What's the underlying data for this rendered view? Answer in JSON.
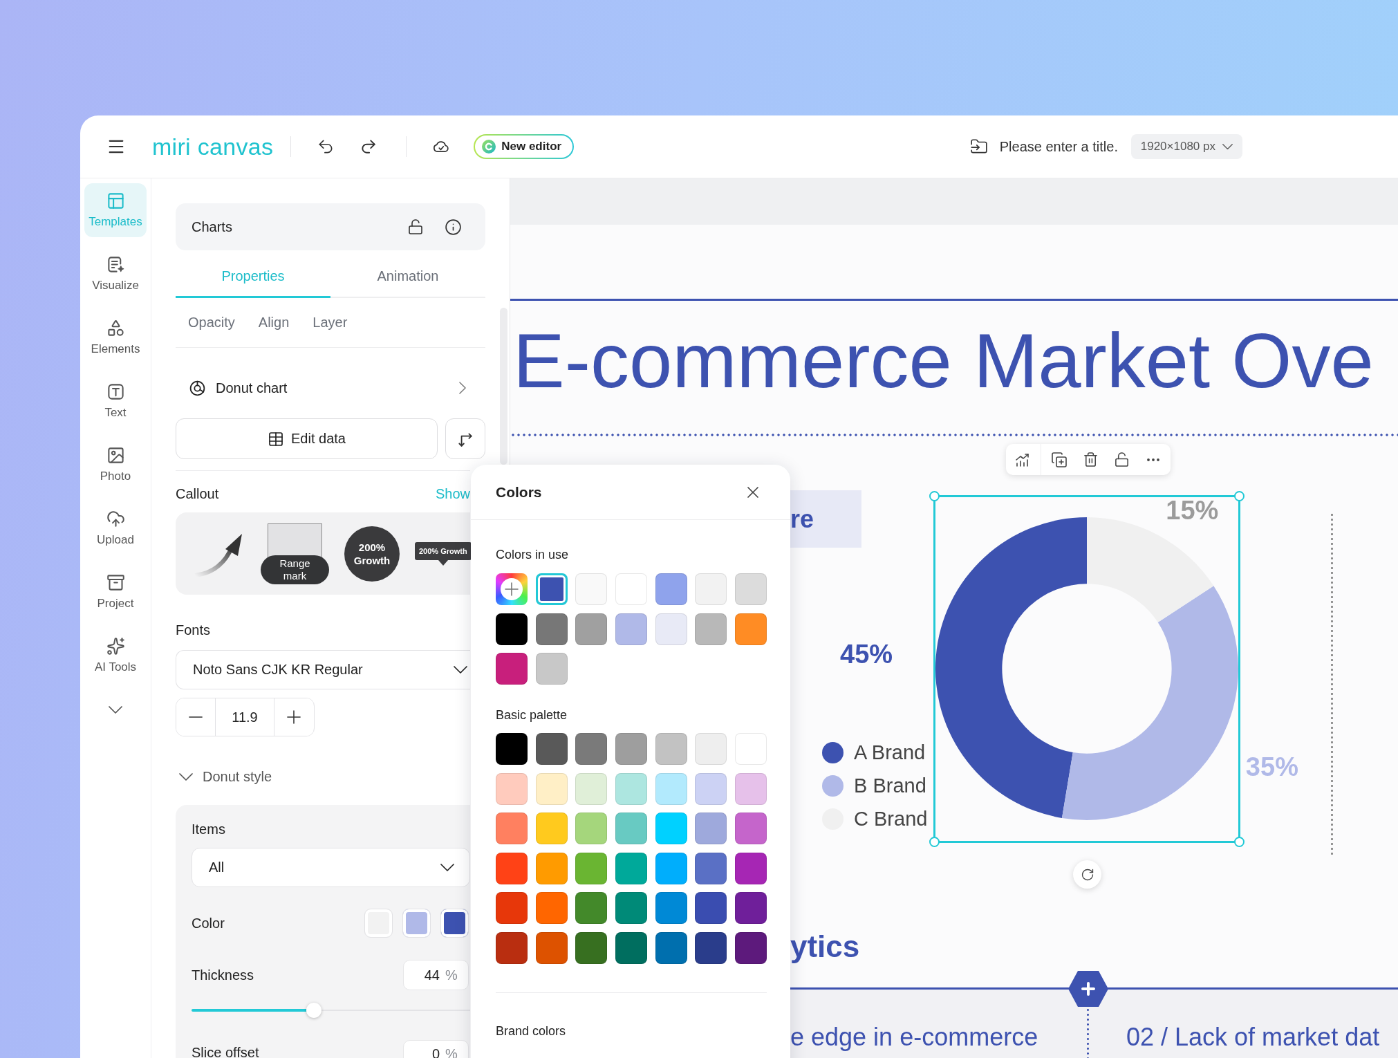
{
  "topbar": {
    "logo": "miri canvas",
    "badge": "New editor",
    "title_field": {
      "placeholder": "Please enter a title."
    },
    "size_select": "1920×1080 px"
  },
  "sidebar": {
    "items": [
      {
        "label": "Templates",
        "selected": true
      },
      {
        "label": "Visualize",
        "selected": false
      },
      {
        "label": "Elements",
        "selected": false
      },
      {
        "label": "Text",
        "selected": false
      },
      {
        "label": "Photo",
        "selected": false
      },
      {
        "label": "Upload",
        "selected": false
      },
      {
        "label": "Project",
        "selected": false
      },
      {
        "label": "AI Tools",
        "selected": false
      }
    ]
  },
  "panel": {
    "title": "Charts",
    "tabs": [
      {
        "label": "Properties",
        "selected": true
      },
      {
        "label": "Animation",
        "selected": false
      }
    ],
    "subtabs": [
      "Opacity",
      "Align",
      "Layer"
    ],
    "chart_type": "Donut chart",
    "edit_button": "Edit data",
    "callout": {
      "label": "Callout",
      "toggle": "Show",
      "options": [
        {
          "kind": "arrow"
        },
        {
          "kind": "range",
          "label": "Range mark"
        },
        {
          "kind": "circle",
          "label": "200% Growth"
        },
        {
          "kind": "tooltip",
          "label": "200% Growth"
        }
      ]
    },
    "fonts": {
      "label": "Fonts",
      "family": "Noto Sans CJK KR Regular",
      "size": "11.9"
    },
    "donut_style": {
      "label": "Donut style",
      "expanded": true,
      "items": {
        "label": "Items",
        "value": "All"
      },
      "color": {
        "label": "Color",
        "swatches": [
          {
            "color": "#f2f2f2"
          },
          {
            "color": "#b0b9e8"
          },
          {
            "color": "#3d52b0"
          }
        ]
      },
      "thickness": {
        "label": "Thickness",
        "value": "44",
        "unit": "%",
        "level": 0.44
      },
      "slice_offset": {
        "label": "Slice offset",
        "value": "0",
        "unit": "%"
      }
    }
  },
  "colors_popup": {
    "title": "Colors",
    "in_use_label": "Colors in use",
    "in_use": [
      {
        "color": "#3d52b0",
        "selected": true
      },
      {
        "color": "#f9f9f9",
        "selected": false
      },
      {
        "color": "#ffffff",
        "selected": false
      },
      {
        "color": "#8fa3ec",
        "selected": false
      },
      {
        "color": "#f2f2f2",
        "selected": false
      },
      {
        "color": "#dcdcdc",
        "selected": false
      },
      {
        "color": "#000000",
        "selected": false
      },
      {
        "color": "#777777",
        "selected": false
      },
      {
        "color": "#a0a0a0",
        "selected": false
      },
      {
        "color": "#b0b9e8",
        "selected": false
      },
      {
        "color": "#e8eaf6",
        "selected": false
      },
      {
        "color": "#b8b8b8",
        "selected": false
      },
      {
        "color": "#ff8c24",
        "selected": false
      },
      {
        "color": "#c81f7c",
        "selected": false
      },
      {
        "color": "#c8c8c8",
        "selected": false
      }
    ],
    "basic_label": "Basic palette",
    "basic": [
      {
        "color": "#000000",
        "selected": false
      },
      {
        "color": "#595959",
        "selected": false
      },
      {
        "color": "#7a7a7a",
        "selected": false
      },
      {
        "color": "#9e9e9e",
        "selected": false
      },
      {
        "color": "#c2c2c2",
        "selected": false
      },
      {
        "color": "#eeeeee",
        "selected": false
      },
      {
        "color": "#ffffff",
        "selected": false
      },
      {
        "color": "#ffcbbd",
        "selected": false
      },
      {
        "color": "#ffefc6",
        "selected": false
      },
      {
        "color": "#e0efd8",
        "selected": false
      },
      {
        "color": "#ade6e0",
        "selected": false
      },
      {
        "color": "#b2eafd",
        "selected": false
      },
      {
        "color": "#ccd2f4",
        "selected": false
      },
      {
        "color": "#e6c1ea",
        "selected": false
      },
      {
        "color": "#ff8060",
        "selected": false
      },
      {
        "color": "#ffca1e",
        "selected": false
      },
      {
        "color": "#a5d67c",
        "selected": false
      },
      {
        "color": "#68cac2",
        "selected": false
      },
      {
        "color": "#00d1ff",
        "selected": false
      },
      {
        "color": "#9ea9dc",
        "selected": false
      },
      {
        "color": "#c565cb",
        "selected": false
      },
      {
        "color": "#ff4216",
        "selected": false
      },
      {
        "color": "#ff9b00",
        "selected": false
      },
      {
        "color": "#6ab532",
        "selected": false
      },
      {
        "color": "#00a99a",
        "selected": false
      },
      {
        "color": "#00aefc",
        "selected": false
      },
      {
        "color": "#5a70c5",
        "selected": false
      },
      {
        "color": "#a626b4",
        "selected": false
      },
      {
        "color": "#e7370a",
        "selected": false
      },
      {
        "color": "#ff6600",
        "selected": false
      },
      {
        "color": "#43892a",
        "selected": false
      },
      {
        "color": "#008a78",
        "selected": false
      },
      {
        "color": "#0089d6",
        "selected": false
      },
      {
        "color": "#3a4db0",
        "selected": false
      },
      {
        "color": "#6f1f9a",
        "selected": false
      },
      {
        "color": "#b92e10",
        "selected": false
      },
      {
        "color": "#dd5200",
        "selected": false
      },
      {
        "color": "#376f20",
        "selected": false
      },
      {
        "color": "#006e5f",
        "selected": false
      },
      {
        "color": "#006fae",
        "selected": false
      },
      {
        "color": "#2a3d8b",
        "selected": false
      },
      {
        "color": "#5d1a7c",
        "selected": false
      }
    ],
    "brand_label": "Brand colors"
  },
  "slide": {
    "title": "E-commerce Market Ove",
    "tag": "re",
    "chart": {
      "slices": [
        {
          "color": "#3d52b0"
        },
        {
          "color": "#b0b9e8"
        },
        {
          "color": "#f0f0f0"
        }
      ],
      "chart_data": {
        "type": "donut",
        "categories": [
          "A Brand",
          "B Brand",
          "C Brand"
        ],
        "values": [
          45,
          35,
          15
        ],
        "value_labels": [
          "45%",
          "35%",
          "15%"
        ],
        "legend": "left"
      }
    },
    "section_title": "ytics",
    "columns": [
      "e edge in e-commerce",
      "02 / Lack of market dat"
    ]
  }
}
